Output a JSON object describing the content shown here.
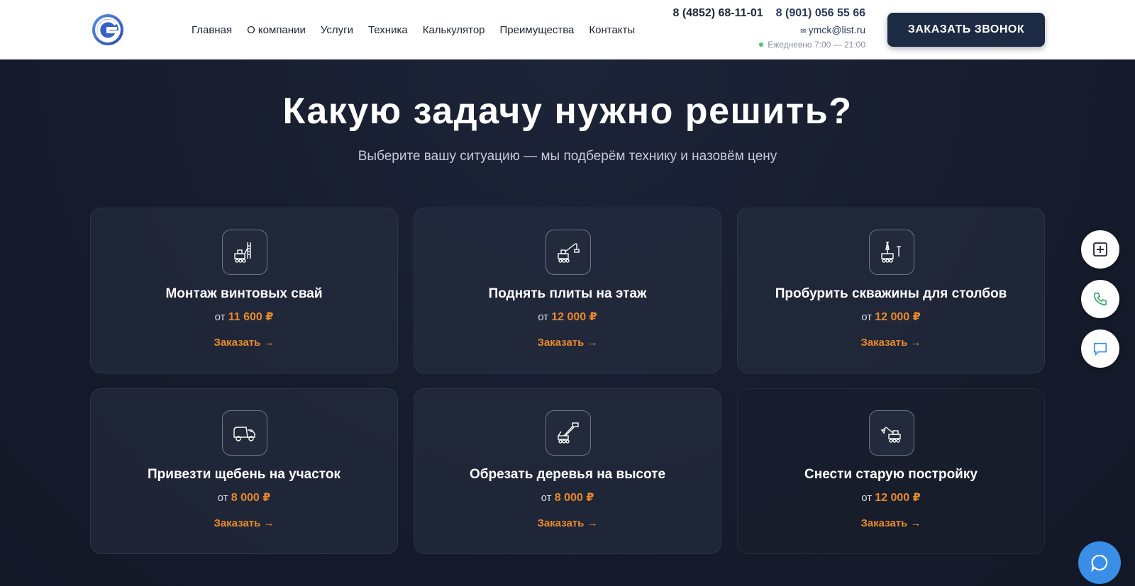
{
  "nav": {
    "items": [
      "Главная",
      "О компании",
      "Услуги",
      "Техника",
      "Калькулятор",
      "Преимущества",
      "Контакты"
    ]
  },
  "contacts": {
    "phone1": "8 (4852) 68-11-01",
    "phone2": "8 (901) 056 55 66",
    "email": "ymck@list.ru",
    "hours": "Ежедневно 7:00 — 21:00"
  },
  "cta_label": "ЗАКАЗАТЬ ЗВОНОК",
  "hero": {
    "title": "Какую задачу нужно решить?",
    "subtitle": "Выберите вашу ситуацию — мы подберём технику и назовём цену"
  },
  "cards": [
    {
      "name": "Монтаж винтовых свай",
      "price_prefix": "от",
      "price": "11 600 ₽",
      "order": "Заказать →",
      "icon": "pile-driver-icon"
    },
    {
      "name": "Поднять плиты на этаж",
      "price_prefix": "от",
      "price": "12 000 ₽",
      "order": "Заказать →",
      "icon": "crane-icon"
    },
    {
      "name": "Пробурить скважины для столбов",
      "price_prefix": "от",
      "price": "12 000 ₽",
      "order": "Заказать →",
      "icon": "drill-rig-icon"
    },
    {
      "name": "Привезти щебень на участок",
      "price_prefix": "от",
      "price": "8 000 ₽",
      "order": "Заказать →",
      "icon": "dump-truck-icon"
    },
    {
      "name": "Обрезать деревья на высоте",
      "price_prefix": "от",
      "price": "8 000 ₽",
      "order": "Заказать →",
      "icon": "aerial-lift-icon"
    },
    {
      "name": "Снести старую постройку",
      "price_prefix": "от",
      "price": "12 000 ₽",
      "order": "Заказать →",
      "icon": "excavator-icon"
    }
  ],
  "colors": {
    "accent": "#e8892b",
    "header_bg": "#ffffff",
    "section_bg": "#161c2c",
    "cta_bg": "#1d2a44",
    "chat_fab": "#3a8ee6"
  }
}
